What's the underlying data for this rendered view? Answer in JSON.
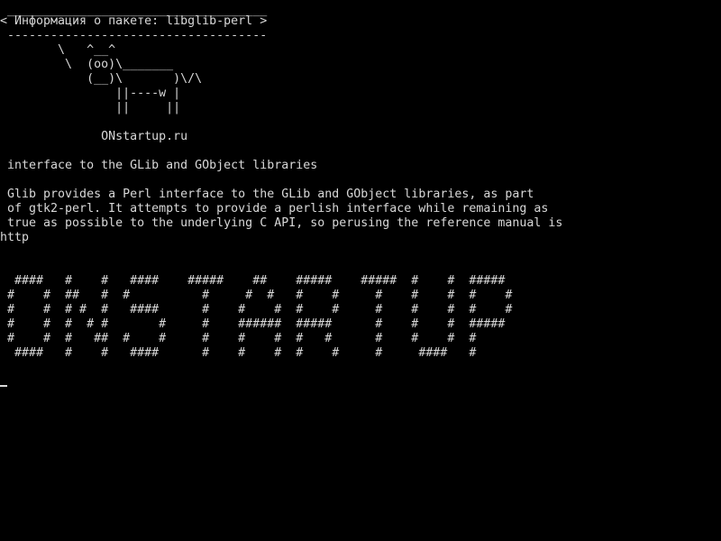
{
  "colors": {
    "background": "#000000",
    "text": "#d8d8d8"
  },
  "terminal": {
    "lines": [
      " ____________________________________",
      "< Информация о пакете: libglib-perl >",
      " ------------------------------------",
      "        \\   ^__^",
      "         \\  (oo)\\_______",
      "            (__)\\       )\\/\\",
      "                ||----w |",
      "                ||     ||",
      "",
      "              ONstartup.ru",
      "",
      " interface to the GLib and GObject libraries",
      "",
      " Glib provides a Perl interface to the GLib and GObject libraries, as part",
      " of gtk2-perl. It attempts to provide a perlish interface while remaining as",
      " true as possible to the underlying C API, so perusing the reference manual is",
      "http",
      "",
      "",
      "  ####   #    #   ####    #####    ##    #####    #####  #    #  #####",
      " #    #  ##   #  #          #     #  #   #    #     #    #    #  #    #",
      " #    #  # #  #   ####      #    #    #  #    #     #    #    #  #    #",
      " #    #  #  # #       #     #    ######  #####      #    #    #  #####",
      " #    #  #   ##  #    #     #    #    #  #   #      #    #    #  #",
      "  ####   #    #   ####      #    #    #  #    #     #     ####   #"
    ]
  }
}
